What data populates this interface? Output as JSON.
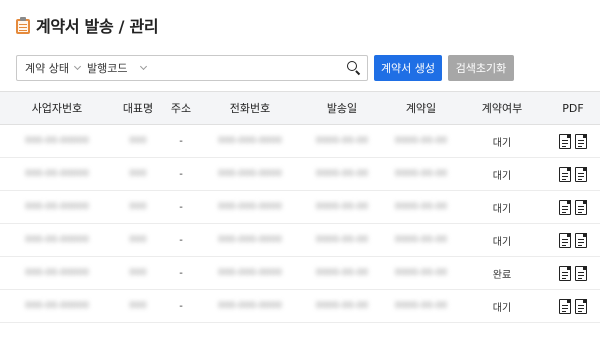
{
  "header": {
    "title": "계약서 발송 / 관리",
    "icon": "clipboard-icon"
  },
  "filter": {
    "status_label": "계약 상태",
    "code_label": "발행코드",
    "search_value": "",
    "search_placeholder": ""
  },
  "buttons": {
    "send": "계약서 생성",
    "reset": "검색초기화"
  },
  "colors": {
    "primary": "#1f6fe5",
    "reset": "#a7a7a7",
    "icon_accent": "#e58a3c"
  },
  "table": {
    "columns": [
      "사업자번호",
      "대표명",
      "주소",
      "전화번호",
      "발송일",
      "계약일",
      "계약여부",
      "PDF"
    ],
    "rows": [
      {
        "biz": "000-00-00000",
        "rep": "000",
        "addr": "-",
        "phone": "000-000-0000",
        "sent": "0000-00-00",
        "date": "0000-00-00",
        "status": "대기"
      },
      {
        "biz": "000-00-00000",
        "rep": "000",
        "addr": "-",
        "phone": "000-000-0000",
        "sent": "0000-00-00",
        "date": "0000-00-00",
        "status": "대기"
      },
      {
        "biz": "000-00-00000",
        "rep": "000",
        "addr": "-",
        "phone": "000-000-0000",
        "sent": "0000-00-00",
        "date": "0000-00-00",
        "status": "대기"
      },
      {
        "biz": "000-00-00000",
        "rep": "000",
        "addr": "-",
        "phone": "000-000-0000",
        "sent": "0000-00-00",
        "date": "0000-00-00",
        "status": "대기"
      },
      {
        "biz": "000-00-00000",
        "rep": "000",
        "addr": "-",
        "phone": "000-000-0000",
        "sent": "0000-00-00",
        "date": "0000-00-00",
        "status": "완료"
      },
      {
        "biz": "000-00-00000",
        "rep": "000",
        "addr": "-",
        "phone": "000-000-0000",
        "sent": "0000-00-00",
        "date": "0000-00-00",
        "status": "대기"
      }
    ]
  }
}
